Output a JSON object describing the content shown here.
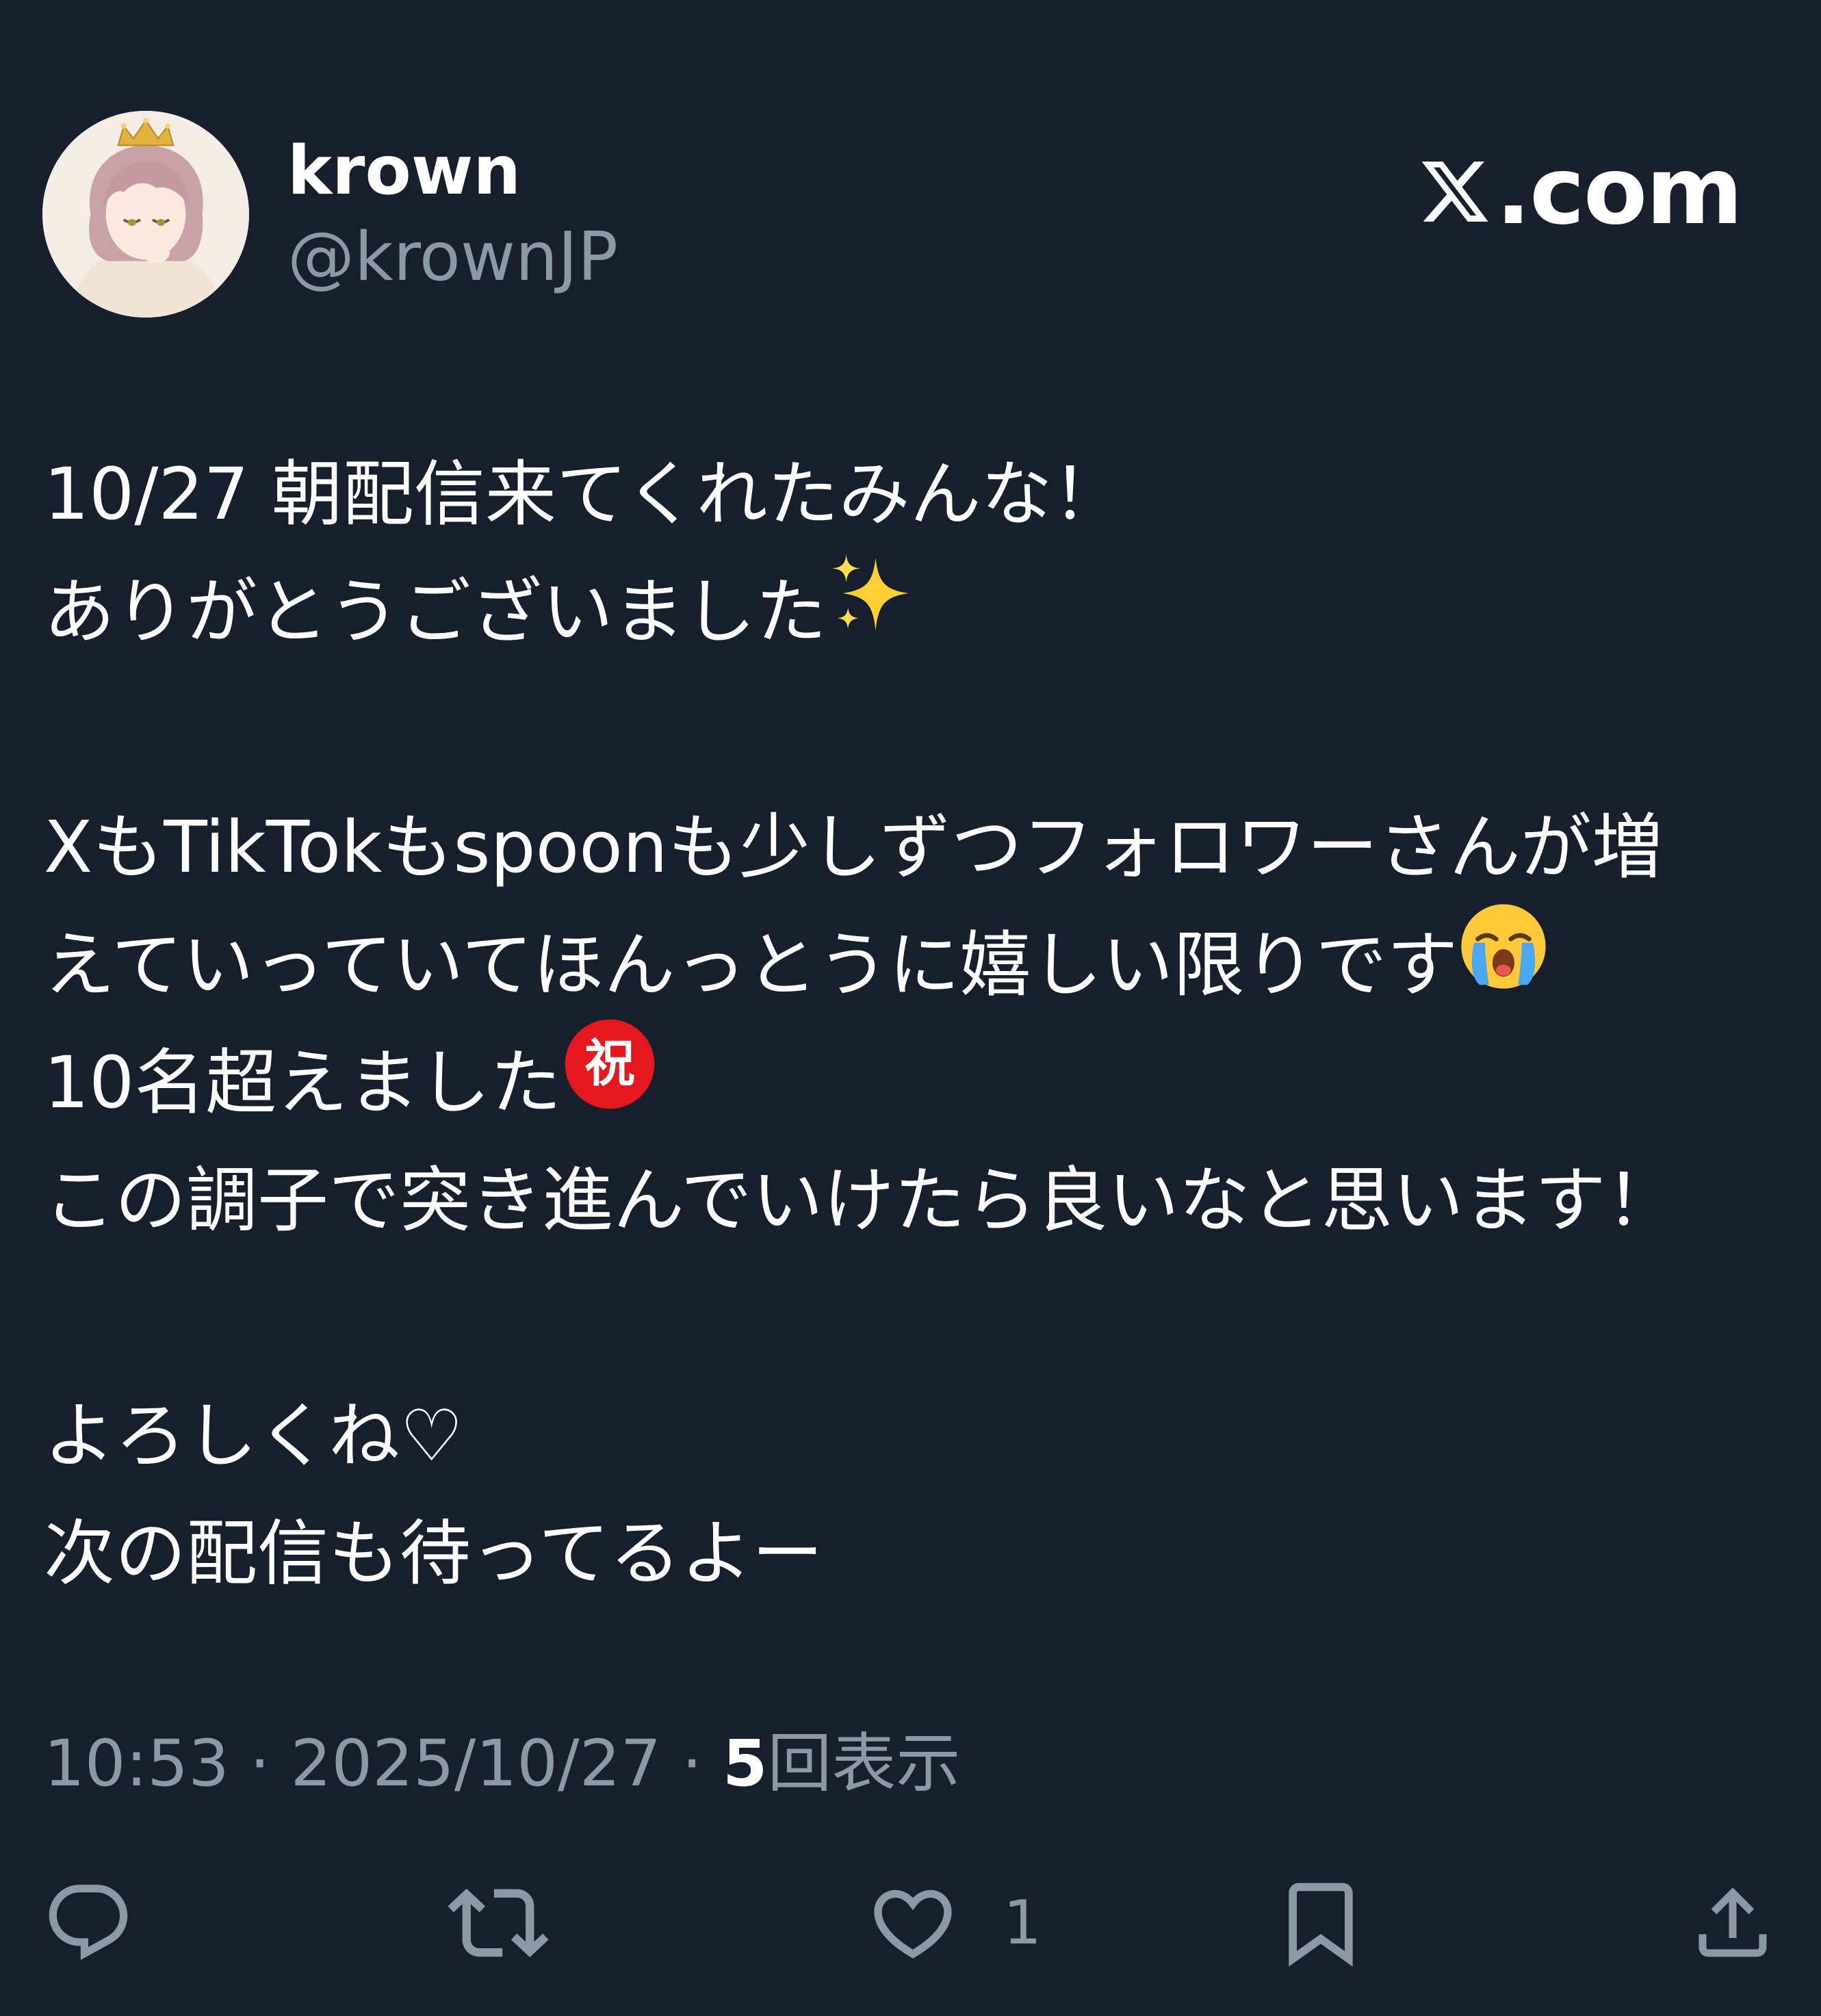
{
  "author": {
    "display_name": "krown",
    "handle": "@krownJP",
    "avatar_signature": "krown"
  },
  "site": {
    "domain_suffix": ".com"
  },
  "tweet": {
    "lines": [
      "10/27  朝配信来てくれたみんな！",
      "ありがとうございました",
      "",
      "XもTikTokもspoonも少しずつフォロワーさんが増",
      "えていっていてほんっとうに嬉しい限りです",
      "10名超えました",
      "この調子で突き進んでいけたら良いなと思います！",
      "",
      "よろしくね♡",
      "次の配信も待ってるよー"
    ],
    "emoji": {
      "sparkles": "sparkles-icon",
      "crying": "loudly-crying-face-icon",
      "congratulations": "congratulations-icon"
    },
    "congrats_char": "祝"
  },
  "meta": {
    "time": "10:53",
    "separator": " · ",
    "date": "2025/10/27",
    "views_count": "5",
    "views_label": "回表示"
  },
  "actions": {
    "reply_icon": "reply-icon",
    "repost_icon": "repost-icon",
    "like_icon": "heart-icon",
    "like_count": "1",
    "bookmark_icon": "bookmark-icon",
    "share_icon": "share-icon"
  },
  "colors": {
    "background": "#161f2b",
    "primary_text": "#ffffff",
    "secondary_text": "#8b98a5"
  }
}
